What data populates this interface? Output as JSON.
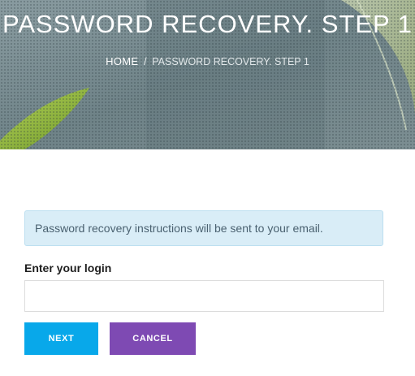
{
  "header": {
    "title": "PASSWORD RECOVERY. STEP 1",
    "breadcrumb": {
      "home": "HOME",
      "separator": "/",
      "current": "PASSWORD RECOVERY. STEP 1"
    }
  },
  "alert": {
    "text": "Password recovery instructions will be sent to your email."
  },
  "form": {
    "login_label": "Enter your login",
    "login_value": "",
    "login_placeholder": ""
  },
  "buttons": {
    "next": "NEXT",
    "cancel": "CANCEL"
  },
  "colors": {
    "next_button": "#08a8ea",
    "cancel_button": "#7e4ab3",
    "alert_background": "#d9edf7"
  },
  "icons": {
    "hero_background": "leaf-background-image"
  }
}
